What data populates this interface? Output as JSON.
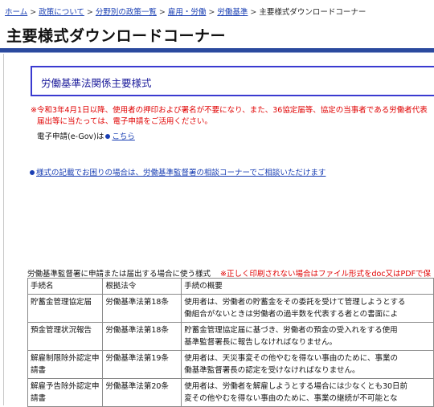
{
  "breadcrumb": {
    "items": [
      "ホーム",
      "政策について",
      "分野別の政策一覧",
      "雇用・労働",
      "労働基準"
    ],
    "separator": ">",
    "current": "主要様式ダウンロードコーナー"
  },
  "page": {
    "title": "主要様式ダウンロードコーナー"
  },
  "section": {
    "title": "労働基準法関係主要様式"
  },
  "notice": {
    "line1": "※令和3年4月1日以降、使用者の押印および署名が不要になり、また、36協定届等、協定の当事者である労働者代表",
    "line2": "届出等に当たっては、電子申請をご活用ください。"
  },
  "egov": {
    "text": "電子申請(e-Gov)は",
    "link": "こちら"
  },
  "consult": {
    "link": "様式の記載でお困りの場合は、労働基準監督署の相談コーナーでご相談いただけます"
  },
  "table": {
    "caption": "労働基準監督署に申請または届出する場合に使う様式",
    "caption_note": "※正しく印刷されない場合はファイル形式をdoc又はPDFで保",
    "headers": [
      "手続名",
      "根拠法令",
      "手続の概要"
    ],
    "rows": [
      {
        "name": "貯蓄金管理協定届",
        "law": "労働基準法第18条",
        "summary_1": "使用者は、労働者の貯蓄金をその委託を受けて管理しようとする",
        "summary_2": "働組合がないときは労働者の過半数を代表する者との書面によ"
      },
      {
        "name": "預金管理状況報告",
        "law": "労働基準法第18条",
        "summary_1": "貯蓄金管理協定届に基づき、労働者の預金の受入れをする使用",
        "summary_2": "基準監督署長に報告しなければなりません。"
      },
      {
        "name": "解雇制限除外認定申請書",
        "law": "労働基準法第19条",
        "summary_1": "使用者は、天災事変その他やむを得ない事由のために、事業の",
        "summary_2": "働基準監督署長の認定を受けなければなりません。"
      },
      {
        "name": "解雇予告除外認定申請書",
        "law": "労働基準法第20条",
        "summary_1": "使用者は、労働者を解雇しようとする場合には少なくとも30日前",
        "summary_2": "変その他やむを得ない事由のために、事業の継続が不可能とな"
      }
    ]
  },
  "colors": {
    "link": "#1a3fb3",
    "notice_red": "#e00000",
    "title_rule": "#2b4a9e",
    "section_border": "#3a3ad0"
  }
}
